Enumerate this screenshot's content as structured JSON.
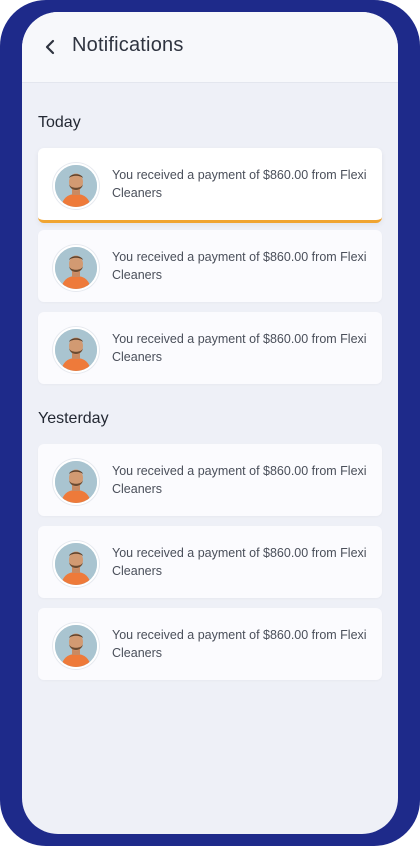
{
  "header": {
    "title": "Notifications",
    "back_icon": "chevron-left-icon"
  },
  "sections": [
    {
      "title": "Today",
      "items": [
        {
          "message": "You received a payment of $860.00 from Flexi Cleaners",
          "highlighted": true
        },
        {
          "message": "You received a payment of $860.00 from Flexi Cleaners",
          "highlighted": false
        },
        {
          "message": "You received a payment of $860.00 from Flexi Cleaners",
          "highlighted": false
        }
      ]
    },
    {
      "title": "Yesterday",
      "items": [
        {
          "message": "You received a payment of $860.00 from Flexi Cleaners",
          "highlighted": false
        },
        {
          "message": "You received a payment of $860.00 from Flexi Cleaners",
          "highlighted": false
        },
        {
          "message": "You received a payment of $860.00 from Flexi Cleaners",
          "highlighted": false
        }
      ]
    }
  ],
  "colors": {
    "frame": "#1e2a8a",
    "highlight_accent": "#f0a430",
    "avatar_shirt": "#ee7a3a"
  }
}
